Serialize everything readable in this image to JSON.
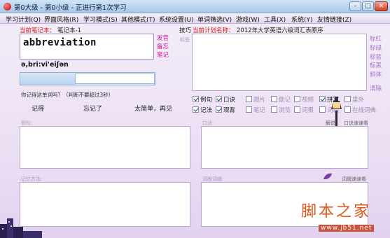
{
  "window": {
    "title": "第0大级 - 第0小级 - 正进行第1次学习",
    "minimize_label": "–",
    "maximize_label": "□",
    "close_label": "✕"
  },
  "menu": {
    "items": [
      "学习计划(Q)",
      "界面风格(R)",
      "学习模式(S)",
      "其他模式(T)",
      "系统设置(U)",
      "单词筛选(V)",
      "游戏(W)",
      "工具(X)",
      "系统(Y)",
      "友情链接(Z)"
    ]
  },
  "notebook": {
    "label": "当前笔记本：",
    "value": "笔记本-1"
  },
  "word": {
    "text": "abbreviation",
    "phonetic": "ə,bri:vi'eiʃən"
  },
  "word_actions": [
    "发音",
    "备忘",
    "笔记"
  ],
  "tips_label": "技巧",
  "plan": {
    "label": "当前计划名称：",
    "value": "2012年大学英语六级词汇表原序"
  },
  "plan_small_label": "标签",
  "mark_actions": [
    "标红",
    "标绿",
    "标蓝",
    "标黑",
    "斜体",
    "清除"
  ],
  "memory_question": "你记得这单词吗？（判断不要超过3秒）",
  "answer_buttons": [
    "记得",
    "忘记了",
    "太简单，再见"
  ],
  "checkbox_rows": [
    [
      {
        "label": "例句",
        "checked": true
      },
      {
        "label": "口诀",
        "checked": true
      },
      {
        "label": "图片",
        "checked": false
      },
      {
        "label": "助记",
        "checked": false
      },
      {
        "label": "视频",
        "checked": false
      },
      {
        "label": "拼写",
        "checked": true
      },
      {
        "label": "里外",
        "checked": false
      }
    ],
    [
      {
        "label": "记法",
        "checked": true
      },
      {
        "label": "观背",
        "checked": true
      },
      {
        "label": "笔记",
        "checked": false
      },
      {
        "label": "浏览",
        "checked": false
      },
      {
        "label": "词根",
        "checked": false
      },
      {
        "label": "词缀",
        "checked": false
      },
      {
        "label": "在线词典",
        "checked": false
      }
    ]
  ],
  "panels": {
    "example": "例句:",
    "mnemonic": "口诀:",
    "mnemonic_side": "解说",
    "mnemonic_side2": "口诀速速看",
    "memory_method": "记忆方法:",
    "root": "词根词缀:",
    "root_side": "词缀速速看"
  },
  "watermark": {
    "brand": "脚本之家",
    "url": "www.jb51.net"
  },
  "colors": {
    "accent_red": "#d41a1a",
    "accent_magenta": "#d0149a",
    "background": "#e9dcf3"
  }
}
